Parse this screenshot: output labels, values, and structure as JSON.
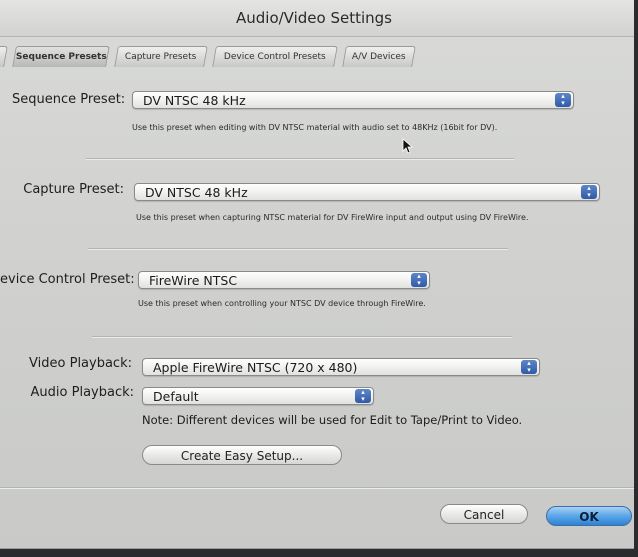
{
  "window": {
    "title": "Audio/Video Settings"
  },
  "tabs": [
    {
      "label": "y"
    },
    {
      "label": "Sequence Presets"
    },
    {
      "label": "Capture Presets"
    },
    {
      "label": "Device Control Presets"
    },
    {
      "label": "A/V Devices"
    }
  ],
  "sequence": {
    "label": "Sequence Preset:",
    "value": "DV NTSC 48 kHz",
    "desc": "Use this preset when editing with DV NTSC material with audio set to 48KHz (16bit for DV)."
  },
  "capture": {
    "label": "Capture Preset:",
    "value": "DV NTSC 48 kHz",
    "desc": "Use this preset when capturing NTSC material for DV FireWire input and output using DV FireWire."
  },
  "device_control": {
    "label": "evice Control Preset:",
    "value": "FireWire NTSC",
    "desc": "Use this preset when controlling your NTSC DV device through FireWire."
  },
  "video_playback": {
    "label": "Video Playback:",
    "value": "Apple FireWire NTSC (720 x 480)"
  },
  "audio_playback": {
    "label": "Audio Playback:",
    "value": "Default"
  },
  "note": "Note: Different devices will be used for Edit to Tape/Print to Video.",
  "buttons": {
    "easy_setup": "Create Easy Setup...",
    "cancel": "Cancel",
    "ok": "OK"
  },
  "colors": {
    "default_button": "#2f82d2",
    "popup_arrows": "#2e5aa8"
  }
}
